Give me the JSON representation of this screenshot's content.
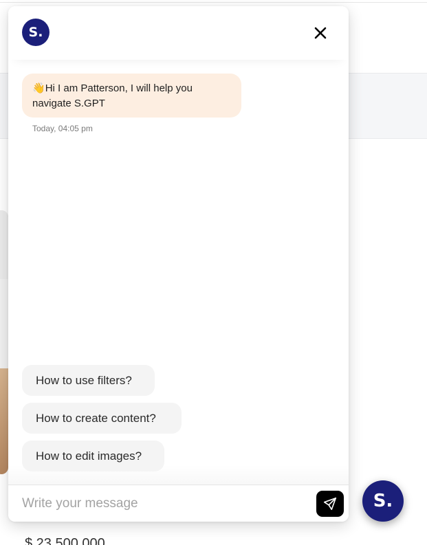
{
  "brand": {
    "logo_text": "S.",
    "launcher_text": "S."
  },
  "chat": {
    "greeting_emoji": "👋",
    "greeting": "Hi I am Patterson, I will help you navigate S.GPT",
    "timestamp": "Today, 04:05 pm",
    "suggestions": [
      "How to use filters?",
      "How to create content?",
      "How to edit images?"
    ],
    "input_placeholder": "Write your message"
  },
  "background": {
    "price": "$ 23,500,000"
  },
  "colors": {
    "brand": "#1b1f7a",
    "bubble": "#fdeee1",
    "chip": "#f4f4f4",
    "send": "#000000"
  },
  "icons": {
    "close": "close-icon",
    "send": "send-icon"
  }
}
